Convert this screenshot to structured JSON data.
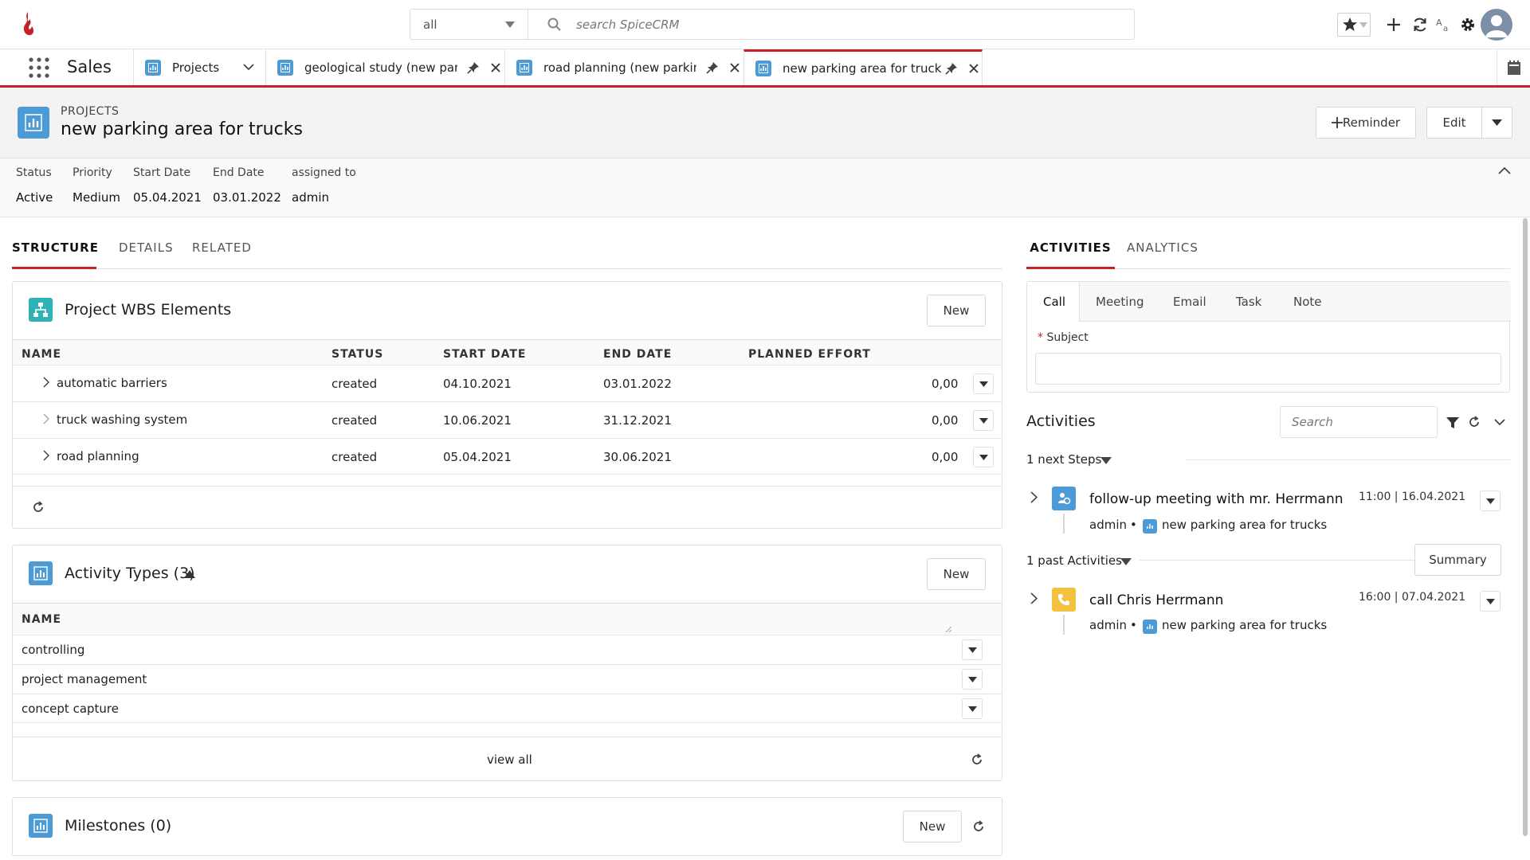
{
  "topbar": {
    "scope_value": "all",
    "search_placeholder": "search SpiceCRM"
  },
  "nav": {
    "module": "Sales",
    "tabs": [
      {
        "label": "Projects"
      },
      {
        "label": "geological study (new parkir"
      },
      {
        "label": "road planning (new parking a"
      },
      {
        "label": "new parking area for trucks"
      }
    ]
  },
  "record": {
    "module_label": "PROJECTS",
    "name": "new parking area for trucks",
    "reminder_label": "Reminder",
    "edit_label": "Edit"
  },
  "fields": [
    {
      "label": "Status",
      "value": "Active"
    },
    {
      "label": "Priority",
      "value": "Medium"
    },
    {
      "label": "Start Date",
      "value": "05.04.2021"
    },
    {
      "label": "End Date",
      "value": "03.01.2022"
    },
    {
      "label": "assigned to",
      "value": "admin"
    }
  ],
  "left_tabs": [
    "STRUCTURE",
    "DETAILS",
    "RELATED"
  ],
  "wbs": {
    "title": "Project WBS Elements",
    "new_label": "New",
    "columns": [
      "NAME",
      "STATUS",
      "START DATE",
      "END DATE",
      "PLANNED EFFORT"
    ],
    "rows": [
      {
        "name": "automatic barriers",
        "status": "created",
        "start": "04.10.2021",
        "end": "03.01.2022",
        "effort": "0,00"
      },
      {
        "name": "truck washing system",
        "status": "created",
        "start": "10.06.2021",
        "end": "31.12.2021",
        "effort": "0,00"
      },
      {
        "name": "road planning",
        "status": "created",
        "start": "05.04.2021",
        "end": "30.06.2021",
        "effort": "0,00"
      }
    ]
  },
  "activity_types": {
    "title": "Activity Types (3)",
    "new_label": "New",
    "column": "NAME",
    "rows": [
      "controlling",
      "project management",
      "concept capture"
    ],
    "view_all": "view all"
  },
  "milestones": {
    "title": "Milestones (0)",
    "new_label": "New"
  },
  "right_tabs": [
    "ACTIVITIES",
    "ANALYTICS"
  ],
  "composer": {
    "tabs": [
      "Call",
      "Meeting",
      "Email",
      "Task",
      "Note"
    ],
    "required_mark": "*",
    "subject_label": "Subject"
  },
  "activities": {
    "title": "Activities",
    "search_placeholder": "Search",
    "next_label": "1 next Steps",
    "past_label": "1 past Activities",
    "summary_label": "Summary",
    "next": {
      "title": "follow-up meeting with mr. Herrmann",
      "time": "11:00 | 16.04.2021",
      "user": "admin",
      "sep": "•",
      "parent": "new parking area for trucks"
    },
    "past": {
      "title": "call Chris Herrmann",
      "time": "16:00 | 07.04.2021",
      "user": "admin",
      "sep": "•",
      "parent": "new parking area for trucks"
    }
  },
  "colors": {
    "accent": "#c82027",
    "project_blue": "#4d9bd6",
    "wbs_teal": "#2fb2b5",
    "call_yellow": "#f2c13e"
  }
}
